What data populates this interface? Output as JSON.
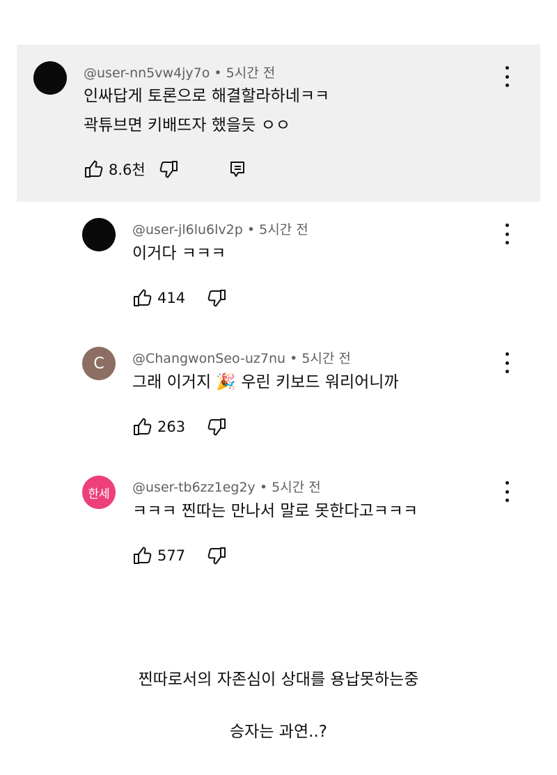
{
  "comments": [
    {
      "handle": "@user-nn5vw4jy7o",
      "time": "• 5시간 전",
      "lines": [
        "인싸답게 토론으로 해결할라하네ㅋㅋ",
        "곽튜브면 키배뜨자 했을듯 ㅇㅇ"
      ],
      "likes": "8.6천",
      "avatar_color": "#0a0a0a",
      "avatar_text": ""
    },
    {
      "handle": "@user-jl6lu6lv2p",
      "time": "• 5시간 전",
      "lines": [
        "이거다 ㅋㅋㅋ"
      ],
      "likes": "414",
      "avatar_color": "#0a0a0a",
      "avatar_text": ""
    },
    {
      "handle": "@ChangwonSeo-uz7nu",
      "time": "• 5시간 전",
      "lines": [
        "그래 이거지 🎉 우린 키보드 워리어니까"
      ],
      "likes": "263",
      "avatar_color": "#8d6e63",
      "avatar_text": "C"
    },
    {
      "handle": "@user-tb6zz1eg2y",
      "time": "• 5시간 전",
      "lines": [
        "ㅋㅋㅋ 찐따는 만나서 말로 못한다고ㅋㅋㅋ"
      ],
      "likes": "577",
      "avatar_color": "#ec407a",
      "avatar_text": "한세"
    }
  ],
  "captions": [
    "찐따로서의 자존심이 상대를 용납못하는중",
    "승자는 과연..?"
  ],
  "icons": {
    "like": "thumbs-up-icon",
    "dislike": "thumbs-down-icon",
    "reply": "reply-icon",
    "more": "kebab-menu-icon"
  }
}
